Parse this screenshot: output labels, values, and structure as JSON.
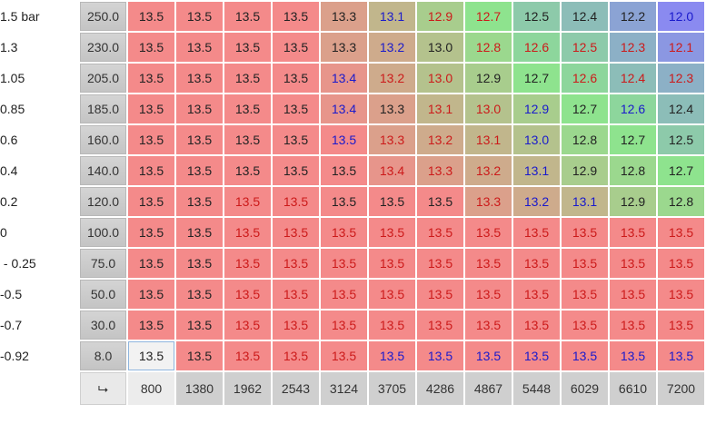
{
  "pressure_labels": [
    "1.5 bar",
    "1.3",
    "1.05",
    "0.85",
    "0.6",
    "0.4",
    "0.2",
    "0",
    " - 0.25",
    "-0.5",
    "-0.7",
    "-0.92"
  ],
  "load_axis": [
    "250.0",
    "230.0",
    "205.0",
    "185.0",
    "160.0",
    "140.0",
    "120.0",
    "100.0",
    "75.0",
    "50.0",
    "30.0",
    "8.0"
  ],
  "rpm_axis": [
    "800",
    "1380",
    "1962",
    "2543",
    "3124",
    "3705",
    "4286",
    "4867",
    "5448",
    "6029",
    "6610",
    "7200"
  ],
  "corner_icon": "axis-swap-icon",
  "corner_glyph": "⮡",
  "values": [
    [
      "13.5",
      "13.5",
      "13.5",
      "13.5",
      "13.3",
      "13.1",
      "12.9",
      "12.7",
      "12.5",
      "12.4",
      "12.2",
      "12.0"
    ],
    [
      "13.5",
      "13.5",
      "13.5",
      "13.5",
      "13.3",
      "13.2",
      "13.0",
      "12.8",
      "12.6",
      "12.5",
      "12.3",
      "12.1"
    ],
    [
      "13.5",
      "13.5",
      "13.5",
      "13.5",
      "13.4",
      "13.2",
      "13.0",
      "12.9",
      "12.7",
      "12.6",
      "12.4",
      "12.3"
    ],
    [
      "13.5",
      "13.5",
      "13.5",
      "13.5",
      "13.4",
      "13.3",
      "13.1",
      "13.0",
      "12.9",
      "12.7",
      "12.6",
      "12.4"
    ],
    [
      "13.5",
      "13.5",
      "13.5",
      "13.5",
      "13.5",
      "13.3",
      "13.2",
      "13.1",
      "13.0",
      "12.8",
      "12.7",
      "12.5"
    ],
    [
      "13.5",
      "13.5",
      "13.5",
      "13.5",
      "13.5",
      "13.4",
      "13.3",
      "13.2",
      "13.1",
      "12.9",
      "12.8",
      "12.7"
    ],
    [
      "13.5",
      "13.5",
      "13.5",
      "13.5",
      "13.5",
      "13.5",
      "13.5",
      "13.3",
      "13.2",
      "13.1",
      "12.9",
      "12.8"
    ],
    [
      "13.5",
      "13.5",
      "13.5",
      "13.5",
      "13.5",
      "13.5",
      "13.5",
      "13.5",
      "13.5",
      "13.5",
      "13.5",
      "13.5"
    ],
    [
      "13.5",
      "13.5",
      "13.5",
      "13.5",
      "13.5",
      "13.5",
      "13.5",
      "13.5",
      "13.5",
      "13.5",
      "13.5",
      "13.5"
    ],
    [
      "13.5",
      "13.5",
      "13.5",
      "13.5",
      "13.5",
      "13.5",
      "13.5",
      "13.5",
      "13.5",
      "13.5",
      "13.5",
      "13.5"
    ],
    [
      "13.5",
      "13.5",
      "13.5",
      "13.5",
      "13.5",
      "13.5",
      "13.5",
      "13.5",
      "13.5",
      "13.5",
      "13.5",
      "13.5"
    ],
    [
      "13.5",
      "13.5",
      "13.5",
      "13.5",
      "13.5",
      "13.5",
      "13.5",
      "13.5",
      "13.5",
      "13.5",
      "13.5",
      "13.5"
    ]
  ],
  "text_colors": [
    [
      "#222",
      "#222",
      "#222",
      "#222",
      "#222",
      "#1a1acc",
      "#cc1a1a",
      "#cc1a1a",
      "#222",
      "#222",
      "#222",
      "#1a1acc"
    ],
    [
      "#222",
      "#222",
      "#222",
      "#222",
      "#222",
      "#1a1acc",
      "#222",
      "#cc1a1a",
      "#cc1a1a",
      "#cc1a1a",
      "#cc1a1a",
      "#cc1a1a"
    ],
    [
      "#222",
      "#222",
      "#222",
      "#222",
      "#1a1acc",
      "#cc1a1a",
      "#cc1a1a",
      "#222",
      "#222",
      "#cc1a1a",
      "#cc1a1a",
      "#cc1a1a"
    ],
    [
      "#222",
      "#222",
      "#222",
      "#222",
      "#1a1acc",
      "#222",
      "#cc1a1a",
      "#cc1a1a",
      "#1a1acc",
      "#222",
      "#1a1acc",
      "#222"
    ],
    [
      "#222",
      "#222",
      "#222",
      "#222",
      "#1a1acc",
      "#cc1a1a",
      "#cc1a1a",
      "#cc1a1a",
      "#1a1acc",
      "#222",
      "#222",
      "#222"
    ],
    [
      "#222",
      "#222",
      "#222",
      "#222",
      "#222",
      "#cc1a1a",
      "#cc1a1a",
      "#cc1a1a",
      "#1a1acc",
      "#222",
      "#222",
      "#222"
    ],
    [
      "#222",
      "#222",
      "#cc1a1a",
      "#cc1a1a",
      "#222",
      "#222",
      "#222",
      "#cc1a1a",
      "#1a1acc",
      "#1a1acc",
      "#222",
      "#222"
    ],
    [
      "#222",
      "#222",
      "#cc1a1a",
      "#cc1a1a",
      "#cc1a1a",
      "#cc1a1a",
      "#cc1a1a",
      "#cc1a1a",
      "#cc1a1a",
      "#cc1a1a",
      "#cc1a1a",
      "#cc1a1a"
    ],
    [
      "#222",
      "#222",
      "#cc1a1a",
      "#cc1a1a",
      "#cc1a1a",
      "#cc1a1a",
      "#cc1a1a",
      "#cc1a1a",
      "#cc1a1a",
      "#cc1a1a",
      "#cc1a1a",
      "#cc1a1a"
    ],
    [
      "#222",
      "#222",
      "#cc1a1a",
      "#cc1a1a",
      "#cc1a1a",
      "#cc1a1a",
      "#cc1a1a",
      "#cc1a1a",
      "#cc1a1a",
      "#cc1a1a",
      "#cc1a1a",
      "#cc1a1a"
    ],
    [
      "#222",
      "#222",
      "#cc1a1a",
      "#cc1a1a",
      "#cc1a1a",
      "#cc1a1a",
      "#cc1a1a",
      "#cc1a1a",
      "#cc1a1a",
      "#cc1a1a",
      "#cc1a1a",
      "#cc1a1a"
    ],
    [
      "#222",
      "#222",
      "#cc1a1a",
      "#cc1a1a",
      "#cc1a1a",
      "#1a1acc",
      "#1a1acc",
      "#1a1acc",
      "#1a1acc",
      "#1a1acc",
      "#1a1acc",
      "#1a1acc"
    ]
  ],
  "heat_colors": {
    "high": "#f48a8a",
    "mid": "#8ee38e",
    "low": "#8a8af0",
    "selected": "#f2f2f2"
  },
  "selected_cell": [
    11,
    0
  ]
}
